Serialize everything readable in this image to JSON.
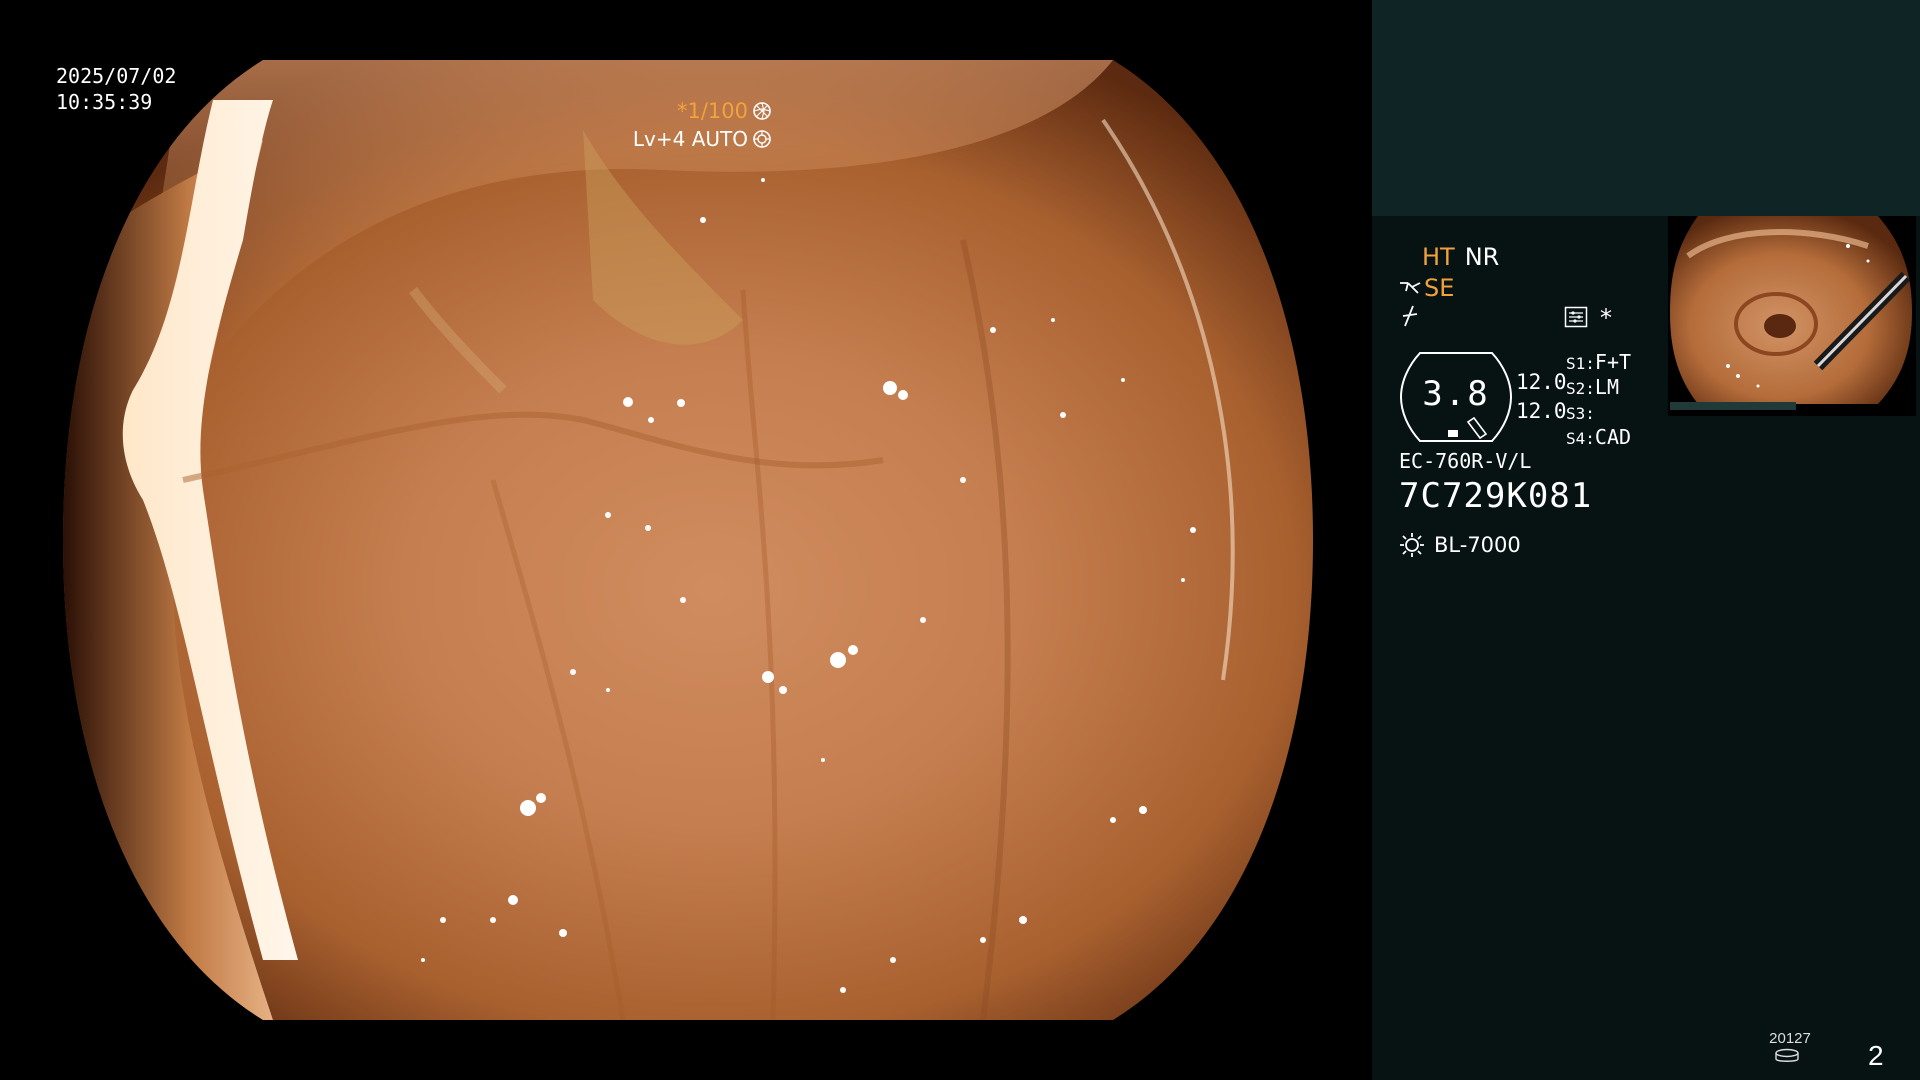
{
  "osd": {
    "date": "2025/07/02",
    "time": "10:35:39",
    "shutter": "*1/100",
    "exposure": "Lv+4 AUTO"
  },
  "panel": {
    "mode_ht": "HT",
    "mode_nr": "NR",
    "mode_se": "SE",
    "star": "*",
    "zoom_value": "3.8",
    "value_1": "12.0",
    "value_2": "12.0",
    "s1_key": "S1:",
    "s1_val": "F+T",
    "s2_key": "S2:",
    "s2_val": "LM",
    "s3_key": "S3:",
    "s3_val": "",
    "s4_key": "S4:",
    "s4_val": "CAD",
    "scope_model": "EC-760R-V/L",
    "scope_serial": "7C729K081",
    "light_source": "BL-7000",
    "image_counter": "20127",
    "page_number": "2"
  },
  "colors": {
    "panel_background": "#071212",
    "panel_top_band": "#0e2425",
    "highlight_orange": "#f2a23c",
    "osd_text": "#ffffff"
  },
  "icons": {
    "shutter": "shutter-aperture-icon",
    "exposure": "auto-exposure-icon",
    "scope_mode": "scope-tip-icon",
    "freeze": "freeze-icon",
    "menu": "settings-menu-icon",
    "light": "light-source-icon",
    "storage": "storage-disk-icon"
  }
}
